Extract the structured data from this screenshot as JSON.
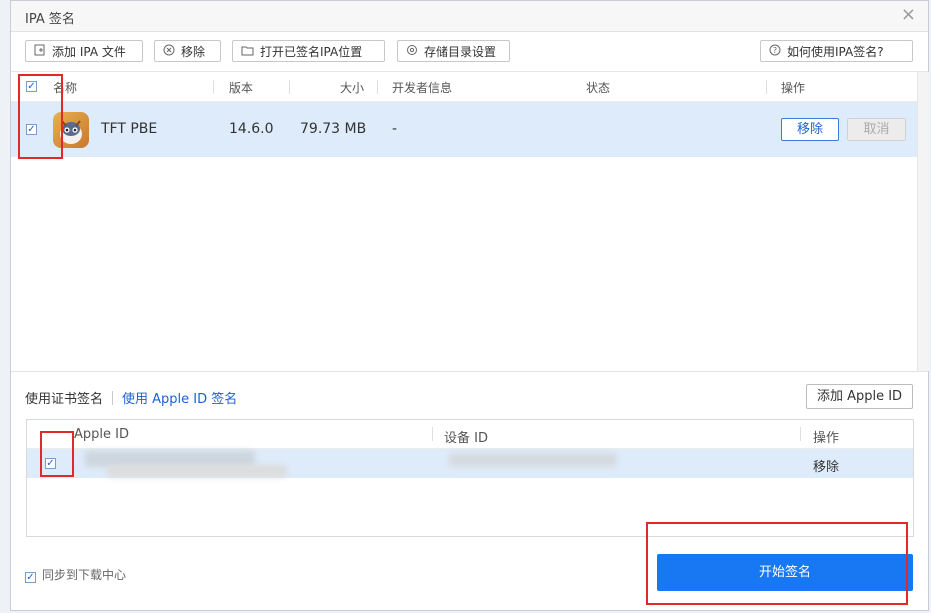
{
  "dialog": {
    "title": "IPA 签名",
    "close_glyph": "×"
  },
  "toolbar": {
    "add_ipa": "添加 IPA 文件",
    "remove": "移除",
    "open_folder": "打开已签名IPA位置",
    "storage_settings": "存储目录设置",
    "help": "如何使用IPA签名?"
  },
  "ipa_table": {
    "headers": {
      "name": "名称",
      "version": "版本",
      "size": "大小",
      "developer": "开发者信息",
      "status": "状态",
      "action": "操作"
    },
    "rows": [
      {
        "checked": true,
        "name": "TFT PBE",
        "version": "14.6.0",
        "size": "79.73 MB",
        "developer": "-",
        "status": "",
        "remove_label": "移除",
        "cancel_label": "取消"
      }
    ]
  },
  "sign_tabs": {
    "cert": "使用证书签名",
    "apple_id": "使用 Apple ID 签名"
  },
  "add_apple_id": "添加 Apple ID",
  "apple_table": {
    "headers": {
      "apple_id": "Apple ID",
      "device_id": "设备 ID",
      "action": "操作"
    },
    "rows": [
      {
        "checked": true,
        "apple_id": "",
        "device_id": "",
        "action": "移除"
      }
    ]
  },
  "sync_label": "同步到下载中心",
  "start_sign": "开始签名",
  "colors": {
    "accent": "#1877f2",
    "highlight_row": "#deebfa",
    "annotation_red": "#e0292a"
  }
}
